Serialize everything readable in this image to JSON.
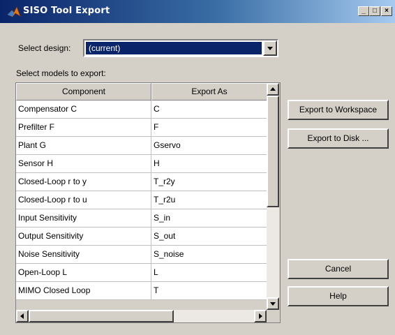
{
  "window": {
    "title": "SISO Tool Export",
    "minimize_label": "_",
    "maximize_label": "□",
    "close_label": "×",
    "icon": "matlab-icon"
  },
  "design": {
    "label": "Select design:",
    "selected": "(current)"
  },
  "models": {
    "label": "Select models to export:",
    "columns": [
      "Component",
      "Export As"
    ],
    "rows": [
      {
        "component": "Compensator C",
        "export_as": "C"
      },
      {
        "component": "Prefilter F",
        "export_as": "F"
      },
      {
        "component": "Plant G",
        "export_as": "Gservo"
      },
      {
        "component": "Sensor H",
        "export_as": "H"
      },
      {
        "component": "Closed-Loop r to y",
        "export_as": "T_r2y"
      },
      {
        "component": "Closed-Loop r to u",
        "export_as": "T_r2u"
      },
      {
        "component": "Input Sensitivity",
        "export_as": "S_in"
      },
      {
        "component": "Output Sensitivity",
        "export_as": "S_out"
      },
      {
        "component": "Noise Sensitivity",
        "export_as": "S_noise"
      },
      {
        "component": "Open-Loop L",
        "export_as": "L"
      },
      {
        "component": "MIMO Closed Loop",
        "export_as": "T"
      }
    ]
  },
  "buttons": {
    "export_workspace": "Export to Workspace",
    "export_disk": "Export to Disk ...",
    "cancel": "Cancel",
    "help": "Help"
  },
  "colors": {
    "title_start": "#0a246a",
    "title_end": "#a6caf0",
    "selection": "#0a246a",
    "face": "#d4d0c8"
  }
}
